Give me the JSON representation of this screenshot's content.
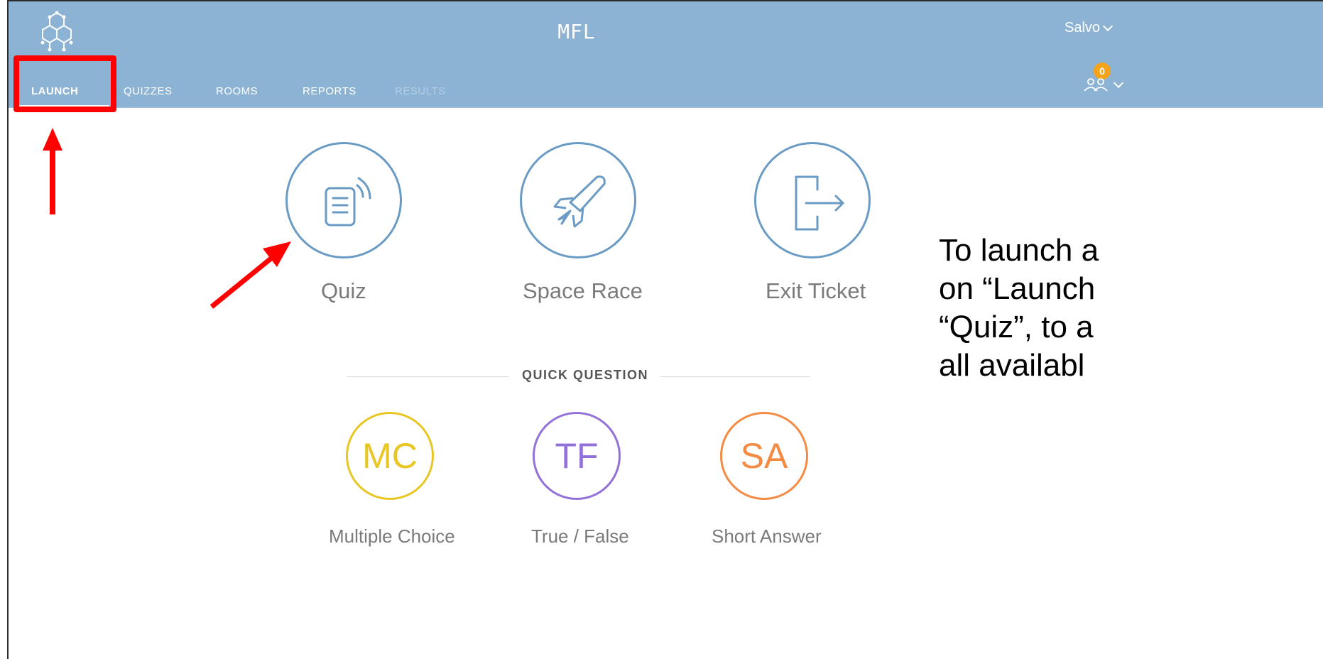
{
  "app": {
    "title": "MFL"
  },
  "user": {
    "name": "Salvo",
    "people_count": "0"
  },
  "nav": {
    "tabs": [
      {
        "label": "LAUNCH",
        "state": "active"
      },
      {
        "label": "QUIZZES",
        "state": "normal"
      },
      {
        "label": "ROOMS",
        "state": "normal"
      },
      {
        "label": "REPORTS",
        "state": "normal"
      },
      {
        "label": "RESULTS",
        "state": "disabled"
      }
    ]
  },
  "activities": [
    {
      "label": "Quiz",
      "icon": "quiz-broadcast-icon"
    },
    {
      "label": "Space Race",
      "icon": "rocket-icon"
    },
    {
      "label": "Exit Ticket",
      "icon": "exit-door-icon"
    }
  ],
  "quick_question": {
    "title": "QUICK QUESTION",
    "options": [
      {
        "abbr": "MC",
        "label": "Multiple Choice",
        "color": "#e8c624"
      },
      {
        "abbr": "TF",
        "label": "True / False",
        "color": "#9271d9"
      },
      {
        "abbr": "SA",
        "label": "Short Answer",
        "color": "#f58a42"
      }
    ]
  },
  "instruction": {
    "lines": [
      "To launch a",
      "on “Launch",
      "“Quiz”, to a",
      "all availabl"
    ]
  },
  "colors": {
    "header": "#8db3d4",
    "activity_stroke": "#6a9bc4",
    "annotation": "#ff0000",
    "badge": "#f5a31a"
  }
}
